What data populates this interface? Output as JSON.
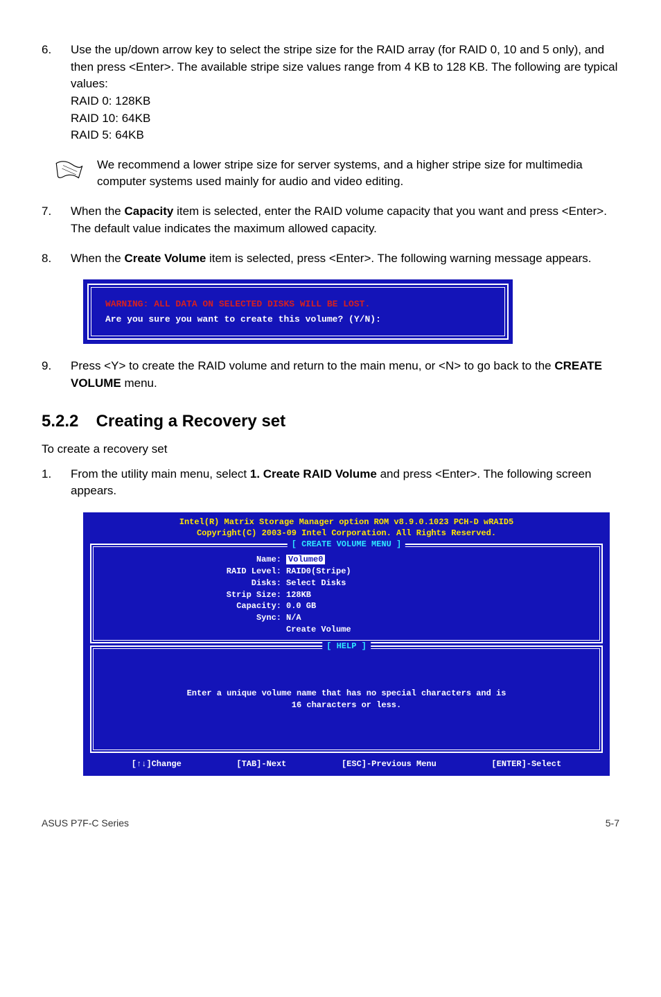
{
  "step6": {
    "num": "6.",
    "text_prefix": "Use the up/down arrow key to select the stripe size for the RAID array (for RAID 0, 10 and 5 only), and then press <Enter>. The available stripe size values range from 4 KB to 128 KB. The following are typical values:",
    "line1": "RAID 0: 128KB",
    "line2": "RAID 10: 64KB",
    "line3": "RAID 5: 64KB"
  },
  "note": "We recommend a lower stripe size for server systems, and a higher stripe size for multimedia computer systems used mainly for audio and video editing.",
  "step7": {
    "num": "7.",
    "p1": "When the ",
    "bold": "Capacity",
    "p2": " item is selected, enter the RAID volume capacity that you want and press <Enter>. The default value indicates the maximum allowed capacity."
  },
  "step8": {
    "num": "8.",
    "p1": "When the ",
    "bold": "Create Volume",
    "p2": " item is selected, press <Enter>. The following warning message appears."
  },
  "warning": {
    "red": "WARNING: ALL DATA ON SELECTED DISKS WILL BE LOST.",
    "white": "Are you sure you want to create this volume? (Y/N):"
  },
  "step9": {
    "num": "9.",
    "p1": "Press <Y> to create the RAID volume and return to the main menu, or <N> to go back to the ",
    "bold": "CREATE VOLUME",
    "p2": " menu."
  },
  "section": {
    "num": "5.2.2",
    "title": "Creating a Recovery set"
  },
  "subtext": "To create a recovery set",
  "step1b": {
    "num": "1.",
    "p1": "From the utility main menu, select ",
    "bold": "1. Create RAID Volume",
    "p2": " and press <Enter>. The following screen appears."
  },
  "bios": {
    "hdr1": "Intel(R) Matrix Storage Manager option ROM v8.9.0.1023 PCH-D wRAID5",
    "hdr2": "Copyright(C) 2003-09 Intel Corporation.  All Rights Reserved.",
    "panel1_title": "[ CREATE VOLUME MENU ]",
    "fields": {
      "name_l": "Name:",
      "name_v": "Volume0",
      "raid_l": "RAID Level:",
      "raid_v": "RAID0(Stripe)",
      "disks_l": "Disks:",
      "disks_v": "Select Disks",
      "strip_l": "Strip Size:",
      "strip_v": " 128KB",
      "cap_l": "Capacity:",
      "cap_v": "0.0   GB",
      "sync_l": "Sync:",
      "sync_v": "N/A",
      "create_v": "Create Volume"
    },
    "panel2_title": "[ HELP ]",
    "help1": "Enter a unique volume name that has no special characters and is",
    "help2": "16 characters or less.",
    "foot1": "[↑↓]Change",
    "foot2": "[TAB]-Next",
    "foot3": "[ESC]-Previous Menu",
    "foot4": "[ENTER]-Select"
  },
  "footer": {
    "left": "ASUS P7F-C Series",
    "right": "5-7"
  }
}
